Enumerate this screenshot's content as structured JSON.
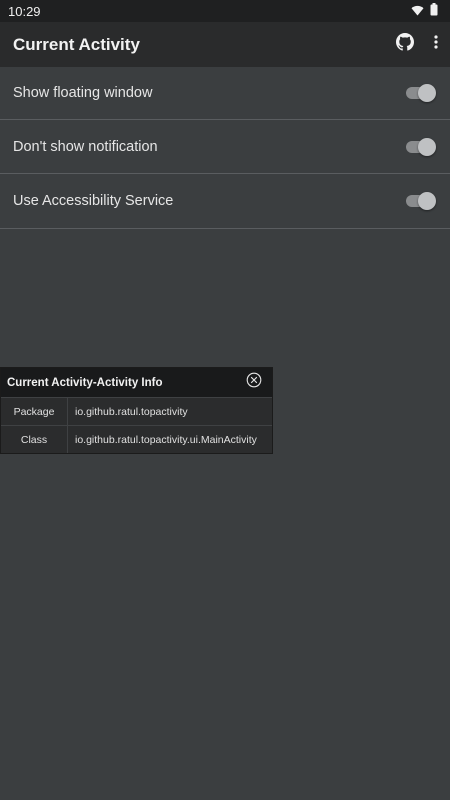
{
  "status_bar": {
    "time": "10:29",
    "icons": [
      "wifi-icon",
      "battery-icon"
    ]
  },
  "app_bar": {
    "title": "Current Activity",
    "actions": [
      "github-icon",
      "more-vert-icon"
    ]
  },
  "settings": [
    {
      "label": "Show floating window",
      "enabled": true
    },
    {
      "label": "Don't show notification",
      "enabled": true
    },
    {
      "label": "Use Accessibility Service",
      "enabled": true
    }
  ],
  "info_panel": {
    "title": "Current Activity-Activity Info",
    "close_icon": "close-circle-icon",
    "rows": [
      {
        "key": "Package",
        "value": "io.github.ratul.topactivity"
      },
      {
        "key": "Class",
        "value": "io.github.ratul.topactivity.ui.MainActivity"
      }
    ]
  },
  "colors": {
    "background": "#3b3e40",
    "app_bar": "#2a2b2c",
    "panel_header": "#191a1b"
  }
}
